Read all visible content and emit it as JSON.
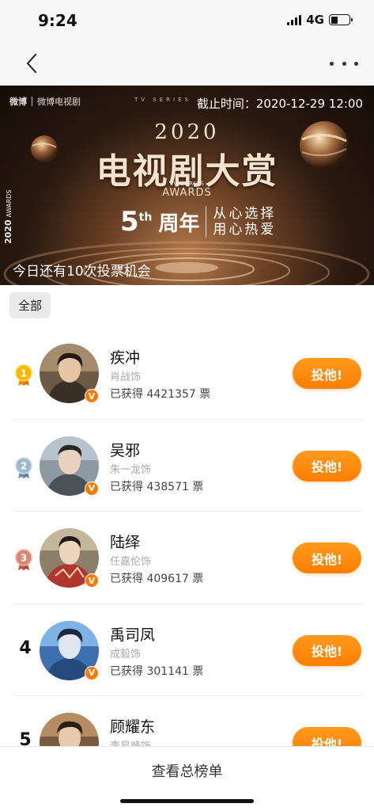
{
  "status_bar": {
    "time": "9:24",
    "network": "4G"
  },
  "nav": {
    "back_icon": "chevron-left-icon",
    "more_icon": "more-horizontal-icon"
  },
  "banner": {
    "logo_weibo": "微博",
    "logo_tv": "微博电视剧",
    "small_title": "TV SERIES",
    "deadline": "截止时间：2020-12-29 12:00",
    "year": "2020",
    "title": "电视剧大赏",
    "sub_small": "TV SERIES",
    "sub": "AWARDS",
    "side_year": "2020",
    "side_text": "AWARDS",
    "anniversary_num": "5",
    "anniversary_suffix": "th",
    "anniversary_label": "周年",
    "slogan_line1": "从心选择",
    "slogan_line2": "用心热爱",
    "vote_chances": "今日还有10次投票机会"
  },
  "filter": {
    "label": "全部"
  },
  "rankings": [
    {
      "rank": "1",
      "name": "疾冲",
      "actor": "肖战饰",
      "votes_text": "已获得 4421357 票",
      "button": "投他!",
      "medal": "gold"
    },
    {
      "rank": "2",
      "name": "吴邪",
      "actor": "朱一龙饰",
      "votes_text": "已获得 438571 票",
      "button": "投他!",
      "medal": "silver"
    },
    {
      "rank": "3",
      "name": "陆绎",
      "actor": "任嘉伦饰",
      "votes_text": "已获得 409617 票",
      "button": "投他!",
      "medal": "bronze"
    },
    {
      "rank": "4",
      "name": "禹司凤",
      "actor": "成毅饰",
      "votes_text": "已获得 301141 票",
      "button": "投他!",
      "medal": ""
    },
    {
      "rank": "5",
      "name": "顾耀东",
      "actor": "李易峰饰",
      "votes_text": "",
      "button": "投他!",
      "medal": ""
    }
  ],
  "bottom": {
    "view_all": "查看总榜单"
  },
  "colors": {
    "accent": "#ff8a00",
    "verified": "#f77b00",
    "gold": "#f5b800",
    "silver": "#9fb6cf",
    "bronze": "#d98873"
  }
}
